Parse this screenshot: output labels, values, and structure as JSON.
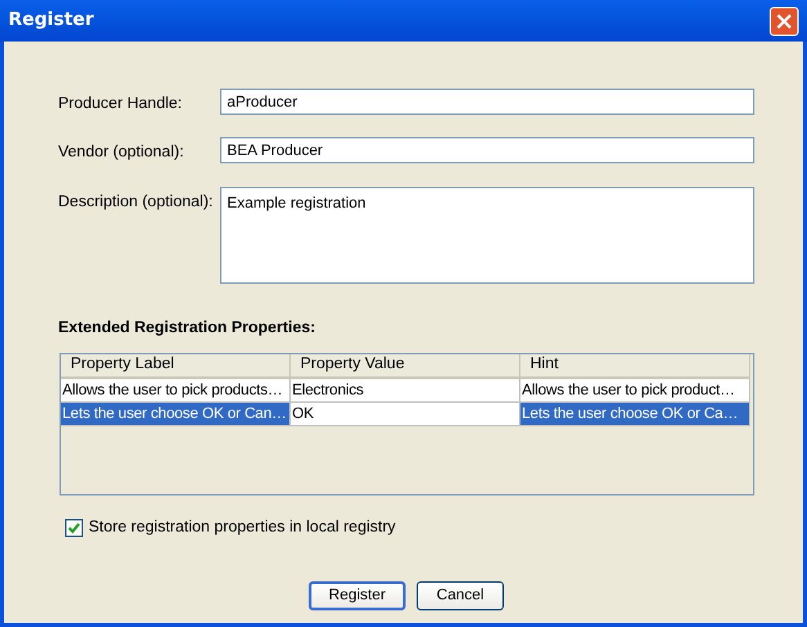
{
  "window": {
    "title": "Register"
  },
  "fields": [
    {
      "label": "Producer Handle:",
      "value": "aProducer",
      "kind": "line"
    },
    {
      "label": "Vendor (optional):",
      "value": "BEA Producer",
      "kind": "line"
    },
    {
      "label": "Description (optional):",
      "value": "Example registration",
      "kind": "area"
    }
  ],
  "section_title": "Extended Registration Properties:",
  "table": {
    "columns": [
      "Property Label",
      "Property Value",
      "Hint"
    ],
    "rows": [
      {
        "cells": [
          "Allows the user to pick products…",
          "Electronics",
          "Allows the user to pick product…"
        ],
        "selected": false
      },
      {
        "cells": [
          "Lets the user choose OK or Can…",
          "OK",
          "Lets the user choose OK or Ca…"
        ],
        "selected": true
      }
    ]
  },
  "checkbox": {
    "label": "Store registration properties in local registry",
    "checked": true
  },
  "buttons": [
    {
      "label": "Register",
      "default": true
    },
    {
      "label": "Cancel",
      "default": false
    }
  ]
}
